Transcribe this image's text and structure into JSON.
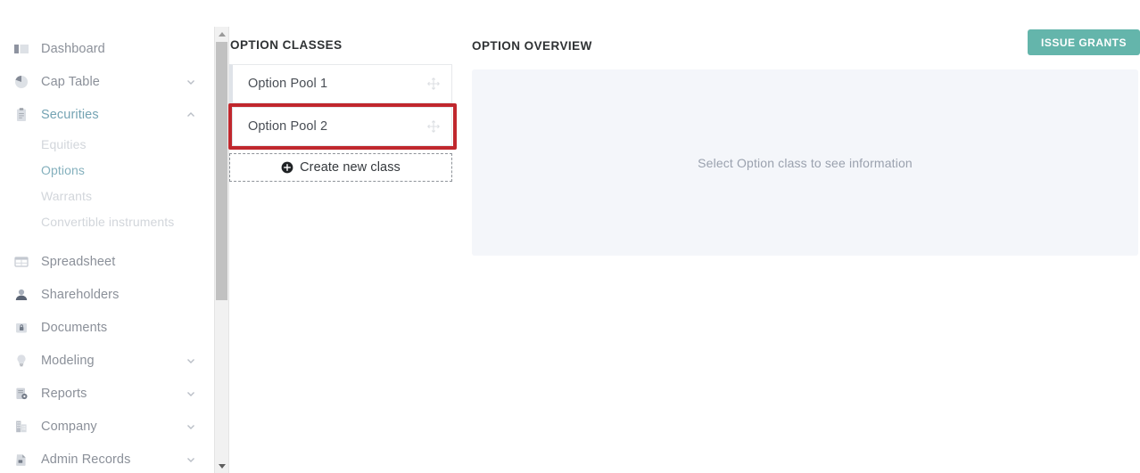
{
  "sidebar": {
    "items": [
      {
        "label": "Dashboard",
        "icon": "dashboard-icon",
        "state": "normal",
        "expandable": false
      },
      {
        "label": "Cap Table",
        "icon": "pie-chart-icon",
        "state": "normal",
        "expandable": true,
        "chevron": "down"
      },
      {
        "label": "Securities",
        "icon": "clipboard-icon",
        "state": "active",
        "expandable": true,
        "chevron": "up"
      },
      {
        "label": "Spreadsheet",
        "icon": "spreadsheet-icon",
        "state": "normal",
        "expandable": false
      },
      {
        "label": "Shareholders",
        "icon": "user-icon",
        "state": "normal",
        "expandable": false
      },
      {
        "label": "Documents",
        "icon": "lock-document-icon",
        "state": "normal",
        "expandable": false
      },
      {
        "label": "Modeling",
        "icon": "lightbulb-icon",
        "state": "normal",
        "expandable": true,
        "chevron": "down"
      },
      {
        "label": "Reports",
        "icon": "report-gear-icon",
        "state": "normal",
        "expandable": true,
        "chevron": "down"
      },
      {
        "label": "Company",
        "icon": "building-icon",
        "state": "normal",
        "expandable": true,
        "chevron": "down"
      },
      {
        "label": "Admin Records",
        "icon": "archive-icon",
        "state": "normal",
        "expandable": true,
        "chevron": "down"
      }
    ],
    "securities_subitems": [
      {
        "label": "Equities",
        "state": "normal"
      },
      {
        "label": "Options",
        "state": "active"
      },
      {
        "label": "Warrants",
        "state": "normal"
      },
      {
        "label": "Convertible instruments",
        "state": "normal"
      }
    ]
  },
  "option_classes": {
    "title": "OPTION CLASSES",
    "cards": [
      {
        "label": "Option Pool 1",
        "handle_icon": "move-handle-icon",
        "highlighted": false
      },
      {
        "label": "Option Pool 2",
        "handle_icon": "move-handle-icon",
        "highlighted": true
      }
    ],
    "create_button": {
      "label": "Create new class",
      "icon": "plus-circle-icon"
    },
    "highlight_color": "#c0272d"
  },
  "overview": {
    "title": "OPTION OVERVIEW",
    "issue_grants_label": "ISSUE GRANTS",
    "issue_grants_color": "#64b5ab",
    "empty_message": "Select Option class to see information",
    "panel_background": "#f4f6fa"
  },
  "scrollbar": {
    "up_icon": "scroll-up-arrow-icon",
    "down_icon": "scroll-down-arrow-icon",
    "thumb": "scrollbar-thumb"
  }
}
